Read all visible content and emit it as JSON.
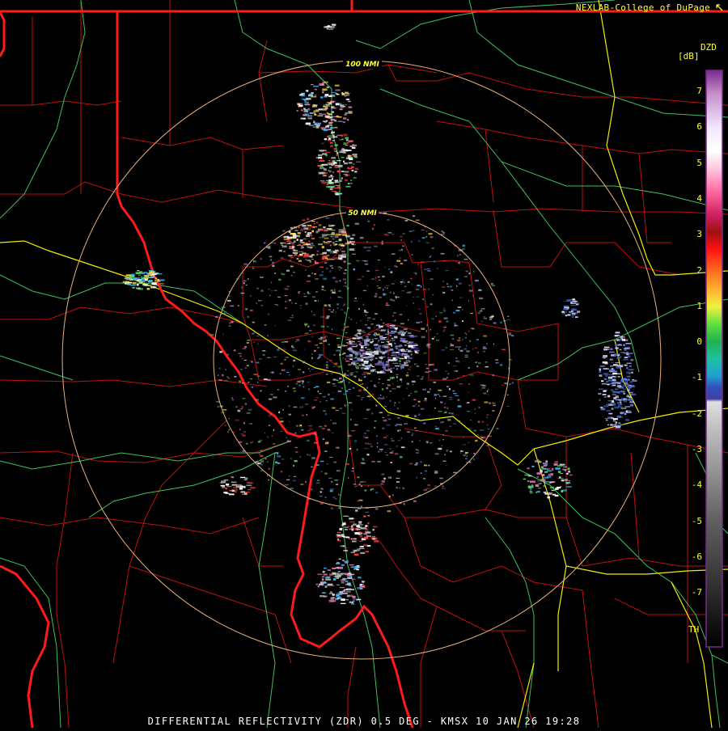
{
  "header": {
    "credit": "NEXLAB-College of DuPage",
    "credit_icon": "external-link-icon"
  },
  "footer": {
    "caption": "DIFFERENTIAL REFLECTIVITY (ZDR) 0.5 DEG - KMSX 10 JAN 26 19:28"
  },
  "map": {
    "range_rings": [
      {
        "label": "100 NMI",
        "range_nmi": 100
      },
      {
        "label": "50 NMI",
        "range_nmi": 50
      }
    ],
    "colors": {
      "state_border": "#ff1a1a",
      "county_border": "#cc1111",
      "highway": "#40c060",
      "interstate": "#f0f000",
      "ring": "#e8b07a"
    }
  },
  "legend": {
    "product": "DZD",
    "unit": "[dB]",
    "ticks": [
      "7",
      "6",
      "5",
      "4",
      "3",
      "2",
      "1",
      "0",
      "-1",
      "-2",
      "-3",
      "-4",
      "-5",
      "-6",
      "-7"
    ],
    "bottom_label": "TH"
  }
}
